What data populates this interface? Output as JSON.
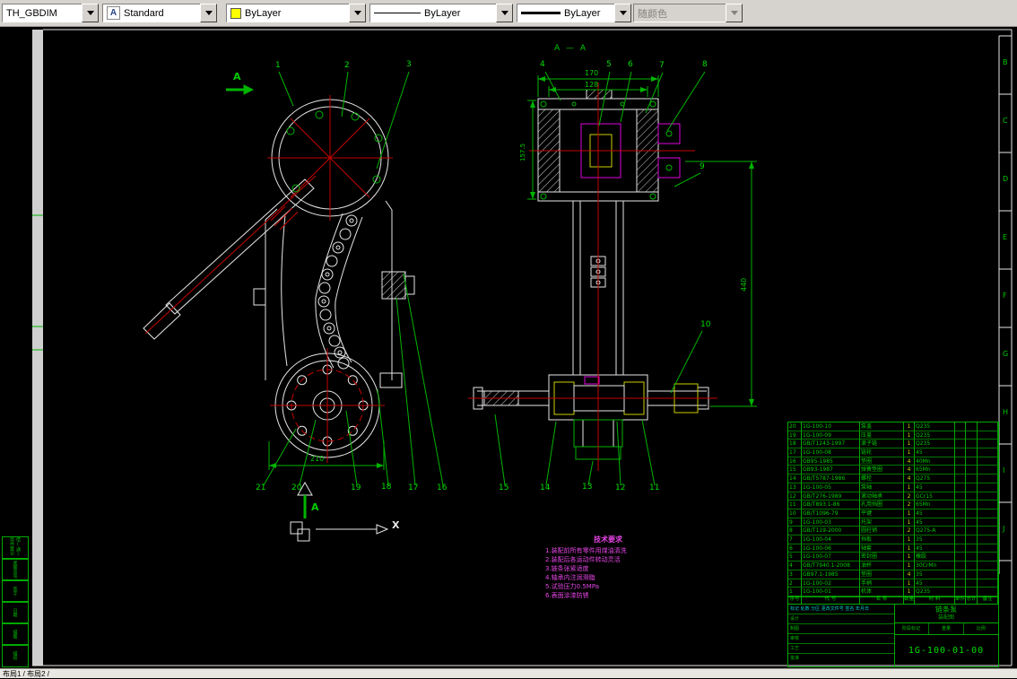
{
  "toolbar": {
    "dimstyle": {
      "value": "TH_GBDIM"
    },
    "textstyle": {
      "value": "Standard",
      "icon_glyph": "A"
    },
    "color": {
      "value": "ByLayer",
      "swatch": "#ffff00"
    },
    "linetype": {
      "value": "ByLayer"
    },
    "lineweight": {
      "value": "ByLayer"
    },
    "plotstyle": {
      "value": "随颜色"
    }
  },
  "statusbar": {
    "tabs": "布局1 / 布局2 /"
  },
  "drawing": {
    "section_title": "A — A",
    "section_marker_top": "A",
    "section_marker_bottom": "A",
    "ucs_x_label": "X",
    "zone_letters": [
      "B",
      "C",
      "D",
      "E",
      "F",
      "G",
      "H",
      "I",
      "J"
    ],
    "balloons": [
      "1",
      "2",
      "3",
      "4",
      "5",
      "6",
      "7",
      "8",
      "9",
      "10",
      "11",
      "12",
      "13",
      "14",
      "15",
      "16",
      "17",
      "18",
      "19",
      "20",
      "21"
    ],
    "dims": {
      "base_width": "210",
      "flange_outer": "170",
      "flange_inner": "128",
      "overall_height": "440",
      "flange_side": "157.5"
    },
    "notes": {
      "title": "技术要求",
      "lines": [
        "1.装配前所有零件用煤油清洗",
        "2.装配后各运动件转动灵活",
        "3.链条张紧适度",
        "4.轴承内注润滑脂",
        "5.试验压力0.5MPa",
        "6.表面涂漆防锈"
      ]
    },
    "parts_table": {
      "header": [
        "序号",
        "代  号",
        "名  称",
        "数量",
        "材  料",
        "单件",
        "总计",
        "备注"
      ],
      "rows": [
        {
          "no": "20",
          "code": "1G-100-10",
          "name": "泵盖",
          "qty": "1",
          "mat": "Q235",
          "note": ""
        },
        {
          "no": "19",
          "code": "1G-100-09",
          "name": "压盖",
          "qty": "1",
          "mat": "Q235",
          "note": ""
        },
        {
          "no": "18",
          "code": "GB/T1243-1997",
          "name": "滚子链",
          "qty": "1",
          "mat": "Q235",
          "note": ""
        },
        {
          "no": "17",
          "code": "1G-100-08",
          "name": "链轮",
          "qty": "1",
          "mat": "45",
          "note": ""
        },
        {
          "no": "16",
          "code": "GB95-1985",
          "name": "垫圈",
          "qty": "4",
          "mat": "40Mn",
          "note": ""
        },
        {
          "no": "15",
          "code": "GB93-1987",
          "name": "弹簧垫圈",
          "qty": "4",
          "mat": "65Mn",
          "note": ""
        },
        {
          "no": "14",
          "code": "GB/T5787-1986",
          "name": "螺栓",
          "qty": "4",
          "mat": "Q275",
          "note": ""
        },
        {
          "no": "13",
          "code": "1G-100-05",
          "name": "泵轴",
          "qty": "1",
          "mat": "45",
          "note": ""
        },
        {
          "no": "12",
          "code": "GB/T276-1989",
          "name": "滚动轴承",
          "qty": "2",
          "mat": "GCr15",
          "note": ""
        },
        {
          "no": "11",
          "code": "GB/T893.1-86",
          "name": "孔用挡圈",
          "qty": "2",
          "mat": "65Mn",
          "note": ""
        },
        {
          "no": "10",
          "code": "GB/T1096-79",
          "name": "平键",
          "qty": "1",
          "mat": "45",
          "note": ""
        },
        {
          "no": "9",
          "code": "1G-100-03",
          "name": "托架",
          "qty": "1",
          "mat": "45",
          "note": ""
        },
        {
          "no": "8",
          "code": "GB/T119-2000",
          "name": "圆柱销",
          "qty": "2",
          "mat": "Q275-A",
          "note": ""
        },
        {
          "no": "7",
          "code": "1G-100-04",
          "name": "挡板",
          "qty": "1",
          "mat": "35",
          "note": ""
        },
        {
          "no": "6",
          "code": "1G-100-06",
          "name": "轴套",
          "qty": "1",
          "mat": "45",
          "note": ""
        },
        {
          "no": "5",
          "code": "1G-100-07",
          "name": "密封圈",
          "qty": "1",
          "mat": "橡胶",
          "note": ""
        },
        {
          "no": "4",
          "code": "GB/T7940.1-2008",
          "name": "油杯",
          "qty": "1",
          "mat": "30CrMn",
          "note": ""
        },
        {
          "no": "3",
          "code": "GB97.1-1985",
          "name": "垫圈",
          "qty": "4",
          "mat": "35",
          "note": ""
        },
        {
          "no": "2",
          "code": "1G-100-02",
          "name": "手柄",
          "qty": "1",
          "mat": "45",
          "note": ""
        },
        {
          "no": "1",
          "code": "1G-100-01",
          "name": "机体",
          "qty": "1",
          "mat": "Q235",
          "note": ""
        }
      ]
    },
    "title_block": {
      "drawing_number": "1G-100-01-00",
      "part_name": "链条泵",
      "sheet_label": "装配图",
      "rev_header": "标记 处数 分区 更改文件号 签名 年月日",
      "left_labels": [
        "设计",
        "制图",
        "审核",
        "工艺",
        "批准"
      ],
      "stage_label": "阶段标记",
      "weight_label": "重量",
      "scale_label": "比例"
    },
    "margin_labels": [
      "借(通)用件登记",
      "底图总号",
      "签字",
      "日期",
      "描图",
      "描校"
    ]
  }
}
